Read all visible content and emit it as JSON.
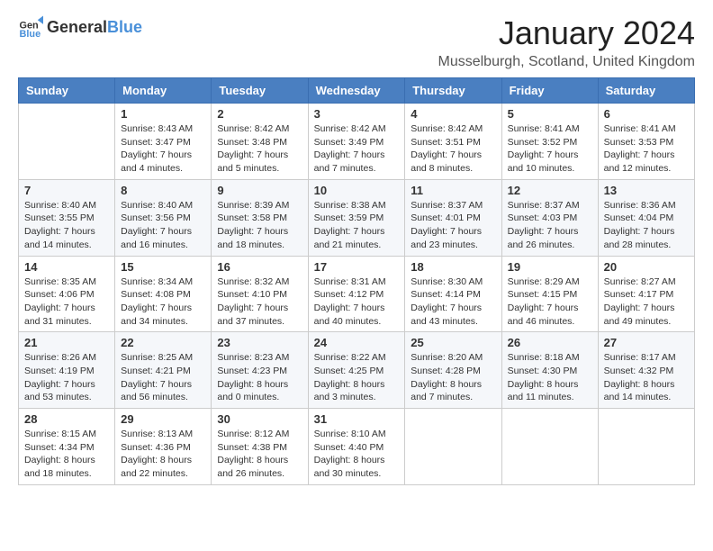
{
  "logo": {
    "text_general": "General",
    "text_blue": "Blue"
  },
  "title": "January 2024",
  "location": "Musselburgh, Scotland, United Kingdom",
  "headers": [
    "Sunday",
    "Monday",
    "Tuesday",
    "Wednesday",
    "Thursday",
    "Friday",
    "Saturday"
  ],
  "weeks": [
    [
      {
        "day": "",
        "sunrise": "",
        "sunset": "",
        "daylight": ""
      },
      {
        "day": "1",
        "sunrise": "Sunrise: 8:43 AM",
        "sunset": "Sunset: 3:47 PM",
        "daylight": "Daylight: 7 hours and 4 minutes."
      },
      {
        "day": "2",
        "sunrise": "Sunrise: 8:42 AM",
        "sunset": "Sunset: 3:48 PM",
        "daylight": "Daylight: 7 hours and 5 minutes."
      },
      {
        "day": "3",
        "sunrise": "Sunrise: 8:42 AM",
        "sunset": "Sunset: 3:49 PM",
        "daylight": "Daylight: 7 hours and 7 minutes."
      },
      {
        "day": "4",
        "sunrise": "Sunrise: 8:42 AM",
        "sunset": "Sunset: 3:51 PM",
        "daylight": "Daylight: 7 hours and 8 minutes."
      },
      {
        "day": "5",
        "sunrise": "Sunrise: 8:41 AM",
        "sunset": "Sunset: 3:52 PM",
        "daylight": "Daylight: 7 hours and 10 minutes."
      },
      {
        "day": "6",
        "sunrise": "Sunrise: 8:41 AM",
        "sunset": "Sunset: 3:53 PM",
        "daylight": "Daylight: 7 hours and 12 minutes."
      }
    ],
    [
      {
        "day": "7",
        "sunrise": "Sunrise: 8:40 AM",
        "sunset": "Sunset: 3:55 PM",
        "daylight": "Daylight: 7 hours and 14 minutes."
      },
      {
        "day": "8",
        "sunrise": "Sunrise: 8:40 AM",
        "sunset": "Sunset: 3:56 PM",
        "daylight": "Daylight: 7 hours and 16 minutes."
      },
      {
        "day": "9",
        "sunrise": "Sunrise: 8:39 AM",
        "sunset": "Sunset: 3:58 PM",
        "daylight": "Daylight: 7 hours and 18 minutes."
      },
      {
        "day": "10",
        "sunrise": "Sunrise: 8:38 AM",
        "sunset": "Sunset: 3:59 PM",
        "daylight": "Daylight: 7 hours and 21 minutes."
      },
      {
        "day": "11",
        "sunrise": "Sunrise: 8:37 AM",
        "sunset": "Sunset: 4:01 PM",
        "daylight": "Daylight: 7 hours and 23 minutes."
      },
      {
        "day": "12",
        "sunrise": "Sunrise: 8:37 AM",
        "sunset": "Sunset: 4:03 PM",
        "daylight": "Daylight: 7 hours and 26 minutes."
      },
      {
        "day": "13",
        "sunrise": "Sunrise: 8:36 AM",
        "sunset": "Sunset: 4:04 PM",
        "daylight": "Daylight: 7 hours and 28 minutes."
      }
    ],
    [
      {
        "day": "14",
        "sunrise": "Sunrise: 8:35 AM",
        "sunset": "Sunset: 4:06 PM",
        "daylight": "Daylight: 7 hours and 31 minutes."
      },
      {
        "day": "15",
        "sunrise": "Sunrise: 8:34 AM",
        "sunset": "Sunset: 4:08 PM",
        "daylight": "Daylight: 7 hours and 34 minutes."
      },
      {
        "day": "16",
        "sunrise": "Sunrise: 8:32 AM",
        "sunset": "Sunset: 4:10 PM",
        "daylight": "Daylight: 7 hours and 37 minutes."
      },
      {
        "day": "17",
        "sunrise": "Sunrise: 8:31 AM",
        "sunset": "Sunset: 4:12 PM",
        "daylight": "Daylight: 7 hours and 40 minutes."
      },
      {
        "day": "18",
        "sunrise": "Sunrise: 8:30 AM",
        "sunset": "Sunset: 4:14 PM",
        "daylight": "Daylight: 7 hours and 43 minutes."
      },
      {
        "day": "19",
        "sunrise": "Sunrise: 8:29 AM",
        "sunset": "Sunset: 4:15 PM",
        "daylight": "Daylight: 7 hours and 46 minutes."
      },
      {
        "day": "20",
        "sunrise": "Sunrise: 8:27 AM",
        "sunset": "Sunset: 4:17 PM",
        "daylight": "Daylight: 7 hours and 49 minutes."
      }
    ],
    [
      {
        "day": "21",
        "sunrise": "Sunrise: 8:26 AM",
        "sunset": "Sunset: 4:19 PM",
        "daylight": "Daylight: 7 hours and 53 minutes."
      },
      {
        "day": "22",
        "sunrise": "Sunrise: 8:25 AM",
        "sunset": "Sunset: 4:21 PM",
        "daylight": "Daylight: 7 hours and 56 minutes."
      },
      {
        "day": "23",
        "sunrise": "Sunrise: 8:23 AM",
        "sunset": "Sunset: 4:23 PM",
        "daylight": "Daylight: 8 hours and 0 minutes."
      },
      {
        "day": "24",
        "sunrise": "Sunrise: 8:22 AM",
        "sunset": "Sunset: 4:25 PM",
        "daylight": "Daylight: 8 hours and 3 minutes."
      },
      {
        "day": "25",
        "sunrise": "Sunrise: 8:20 AM",
        "sunset": "Sunset: 4:28 PM",
        "daylight": "Daylight: 8 hours and 7 minutes."
      },
      {
        "day": "26",
        "sunrise": "Sunrise: 8:18 AM",
        "sunset": "Sunset: 4:30 PM",
        "daylight": "Daylight: 8 hours and 11 minutes."
      },
      {
        "day": "27",
        "sunrise": "Sunrise: 8:17 AM",
        "sunset": "Sunset: 4:32 PM",
        "daylight": "Daylight: 8 hours and 14 minutes."
      }
    ],
    [
      {
        "day": "28",
        "sunrise": "Sunrise: 8:15 AM",
        "sunset": "Sunset: 4:34 PM",
        "daylight": "Daylight: 8 hours and 18 minutes."
      },
      {
        "day": "29",
        "sunrise": "Sunrise: 8:13 AM",
        "sunset": "Sunset: 4:36 PM",
        "daylight": "Daylight: 8 hours and 22 minutes."
      },
      {
        "day": "30",
        "sunrise": "Sunrise: 8:12 AM",
        "sunset": "Sunset: 4:38 PM",
        "daylight": "Daylight: 8 hours and 26 minutes."
      },
      {
        "day": "31",
        "sunrise": "Sunrise: 8:10 AM",
        "sunset": "Sunset: 4:40 PM",
        "daylight": "Daylight: 8 hours and 30 minutes."
      },
      {
        "day": "",
        "sunrise": "",
        "sunset": "",
        "daylight": ""
      },
      {
        "day": "",
        "sunrise": "",
        "sunset": "",
        "daylight": ""
      },
      {
        "day": "",
        "sunrise": "",
        "sunset": "",
        "daylight": ""
      }
    ]
  ]
}
